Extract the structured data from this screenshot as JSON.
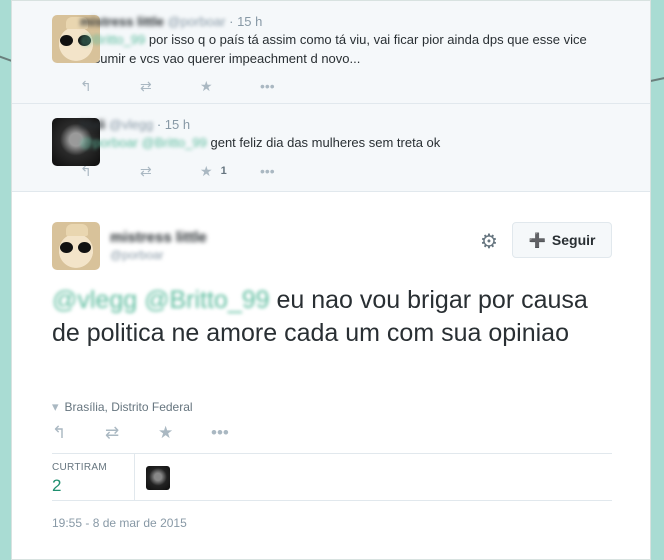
{
  "replies": [
    {
      "name": "mistress little",
      "handle": "@porboar",
      "time": "15 h",
      "mention": "@Britto_99",
      "text": "por isso q o país tá assim como tá viu, vai ficar pior ainda dps que esse vice assumir e vcs vao querer impeachment d novo...",
      "likes": ""
    },
    {
      "name": "Mali",
      "handle": "@vlegg",
      "time": "15 h",
      "mention": "@porboar @Britto_99",
      "text": "gent feliz dia das mulheres sem treta ok",
      "likes": "1"
    }
  ],
  "main": {
    "name": "mistress little",
    "handle": "@porboar",
    "follow_label": "Seguir",
    "mentions": "@vlegg @Britto_99",
    "text": "eu nao vou brigar por causa de politica ne amore cada um com sua opiniao",
    "location": "Brasília, Distrito Federal",
    "likes_label": "CURTIRAM",
    "likes_count": "2",
    "timestamp": "19:55 - 8 de mar de 2015"
  },
  "icons": {
    "reply": "reply-icon",
    "retweet": "retweet-icon",
    "favorite": "star-icon",
    "more": "more-icon",
    "gear": "gear-icon",
    "follow": "add-person-icon",
    "location": "pin-icon"
  },
  "colors": {
    "page_bg": "#a9dcd3",
    "mention": "#5ebd9f",
    "follow_icon": "#55acee",
    "likes_count": "#1f8f6f"
  }
}
